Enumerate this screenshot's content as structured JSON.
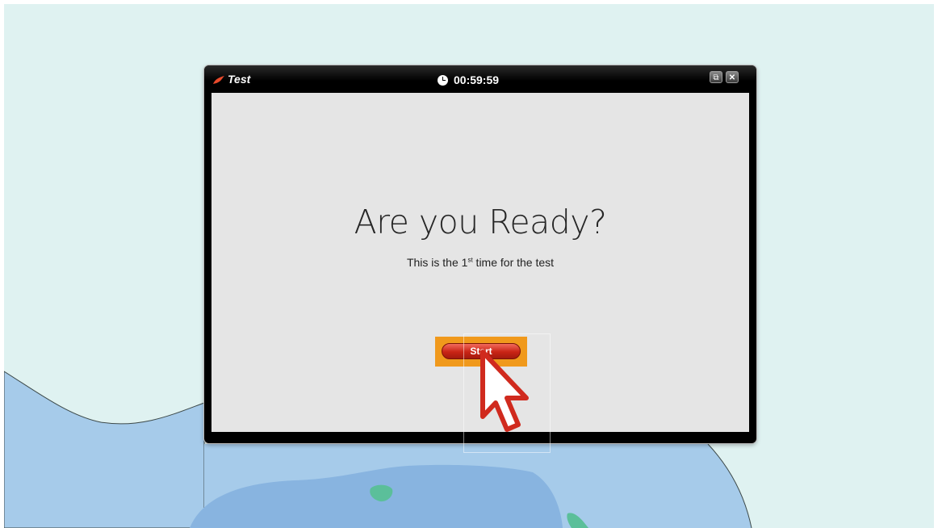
{
  "window": {
    "title": "Test",
    "timer": "00:59:59",
    "restore_label": "⧉",
    "close_label": "✕"
  },
  "main": {
    "heading": "Are you Ready?",
    "subtext_before": "This is the 1",
    "subtext_sup": "st",
    "subtext_after": " time for the test",
    "start_label": "Start"
  },
  "icons": {
    "logo": "flame-logo-icon",
    "clock": "clock-icon",
    "cursor": "mouse-pointer-icon"
  },
  "colors": {
    "highlight": "#f0991c",
    "start_button": "#c92415",
    "map_land": "#dff2f1",
    "map_water": "#a6cbea",
    "map_deep_water": "#88b4e0",
    "map_island": "#5bbf9a"
  }
}
